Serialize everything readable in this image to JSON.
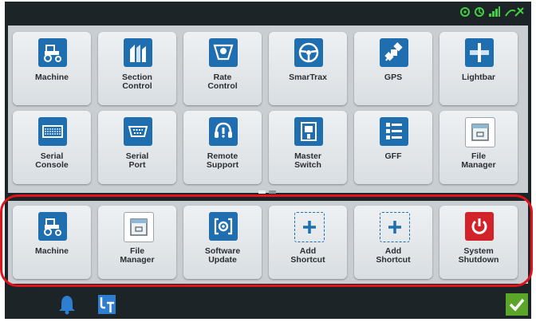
{
  "colors": {
    "tile_icon_bg": "#1f6fb0",
    "shutdown_bg": "#d2232a",
    "highlight": "#e1121c",
    "confirm_bg": "#5aa52a",
    "status_green": "#3fd13f"
  },
  "status_bar": {
    "icons": [
      "gps-signal-icon",
      "gnss-status-icon",
      "cellular-signal-icon",
      "wifi-off-icon"
    ]
  },
  "apps": [
    {
      "label": "Machine",
      "icon": "tractor-icon"
    },
    {
      "label": "Section\nControl",
      "icon": "section-control-icon"
    },
    {
      "label": "Rate\nControl",
      "icon": "rate-control-icon"
    },
    {
      "label": "SmarTrax",
      "icon": "steering-wheel-icon"
    },
    {
      "label": "GPS",
      "icon": "satellite-icon"
    },
    {
      "label": "Lightbar",
      "icon": "lightbar-icon"
    },
    {
      "label": "Serial\nConsole",
      "icon": "serial-console-icon"
    },
    {
      "label": "Serial\nPort",
      "icon": "serial-port-icon"
    },
    {
      "label": "Remote\nSupport",
      "icon": "headset-icon"
    },
    {
      "label": "Master\nSwitch",
      "icon": "master-switch-icon"
    },
    {
      "label": "GFF",
      "icon": "gff-icon"
    },
    {
      "label": "File\nManager",
      "icon": "file-manager-icon"
    }
  ],
  "pager": {
    "pages": 2,
    "current": 1
  },
  "shortcuts": [
    {
      "label": "Machine",
      "icon": "tractor-icon"
    },
    {
      "label": "File\nManager",
      "icon": "file-manager-icon"
    },
    {
      "label": "Software\nUpdate",
      "icon": "software-update-icon"
    },
    {
      "label": "Add\nShortcut",
      "icon": "add-shortcut-icon"
    },
    {
      "label": "Add\nShortcut",
      "icon": "add-shortcut-icon"
    },
    {
      "label": "System\nShutdown",
      "icon": "power-icon"
    }
  ],
  "bottom_bar": {
    "icons": [
      "notification-bell-icon",
      "universal-terminal-icon",
      "confirm-check-icon"
    ]
  }
}
